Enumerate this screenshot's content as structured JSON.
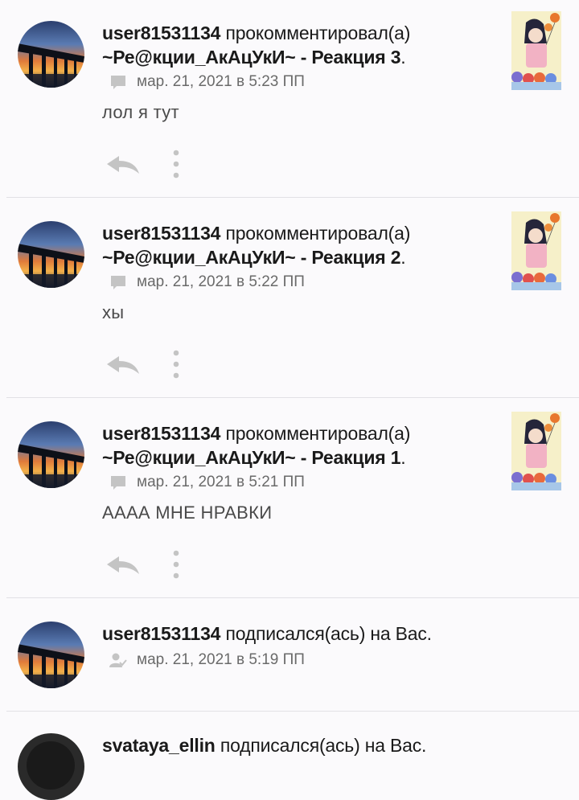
{
  "notifications": [
    {
      "user": "user81531134",
      "action": "прокомментировал(а)",
      "story": "~Ре@кции_АкАцУкИ~ - Реакция 3",
      "suffix": ".",
      "meta_icon": "comment-icon",
      "date": "мар. 21, 2021 в 5:23 ПП",
      "comment": "лол я тут"
    },
    {
      "user": "user81531134",
      "action": "прокомментировал(а)",
      "story": "~Ре@кции_АкАцУкИ~ - Реакция 2",
      "suffix": ".",
      "meta_icon": "comment-icon",
      "date": "мар. 21, 2021 в 5:22 ПП",
      "comment": "хы"
    },
    {
      "user": "user81531134",
      "action": "прокомментировал(а)",
      "story": "~Ре@кции_АкАцУкИ~ - Реакция 1",
      "suffix": ".",
      "meta_icon": "comment-icon",
      "date": "мар. 21, 2021 в 5:21 ПП",
      "comment": "АААА МНЕ НРАВКИ"
    },
    {
      "user": "user81531134",
      "action": "подписался(ась) на Вас.",
      "meta_icon": "follow-icon",
      "date": "мар. 21, 2021 в 5:19 ПП"
    },
    {
      "user": "svataya_ellin",
      "action": "подписался(ась) на Вас."
    }
  ],
  "colors": {
    "background": "#fbfafc",
    "text": "#1a1a1a",
    "meta_text": "#6a6a6a",
    "icon": "#c4c4c4",
    "divider": "#e2e1e5"
  }
}
